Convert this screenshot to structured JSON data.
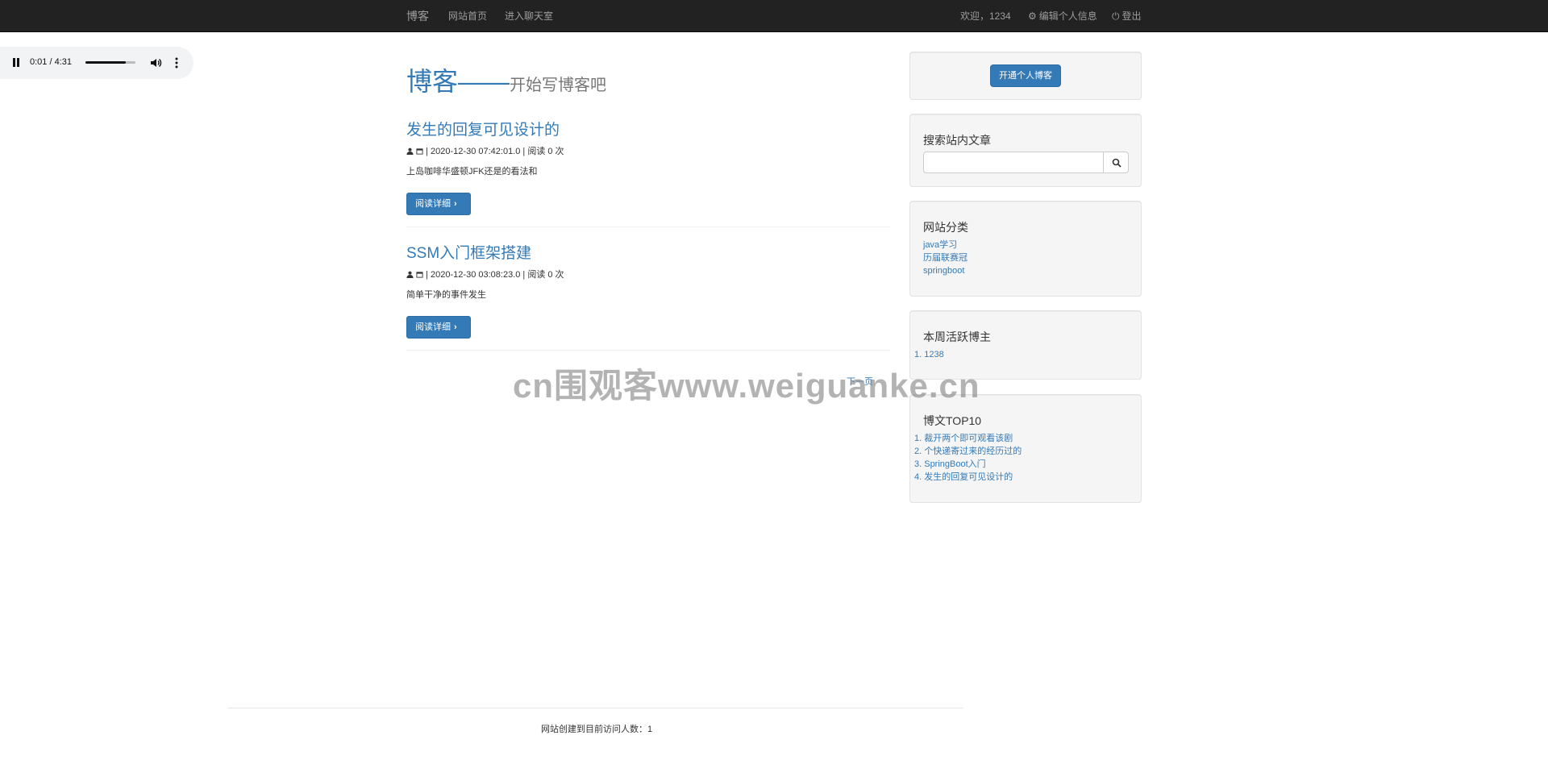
{
  "navbar": {
    "brand": "博客",
    "home": "网站首页",
    "chat": "进入聊天室",
    "welcome": "欢迎，1234",
    "edit_profile": "编辑个人信息",
    "logout": "登出"
  },
  "audio": {
    "time": "0:01 / 4:31",
    "progress": 0.004
  },
  "hero": {
    "title": "博客——",
    "subtitle": "开始写博客吧"
  },
  "posts": [
    {
      "title": "发生的回复可见设计的",
      "meta": "| 2020-12-30 07:42:01.0 | 阅读 0 次",
      "summary": "上岛咖啡华盛顿JFK还是的看法和",
      "button": "阅读详细"
    },
    {
      "title": "SSM入门框架搭建",
      "meta": "| 2020-12-30 03:08:23.0 | 阅读 0 次",
      "summary": "简单干净的事件发生",
      "button": "阅读详细"
    }
  ],
  "pager": {
    "next": "下一页"
  },
  "sidebar": {
    "open_blog": "开通个人博客",
    "search_title": "搜索站内文章",
    "search_value": "",
    "categories_title": "网站分类",
    "categories": [
      "java学习",
      "历届联赛冠",
      "springboot"
    ],
    "active_title": "本周活跃博主",
    "active_bloggers": [
      "1. 1238"
    ],
    "top_title": "博文TOP10",
    "top_posts": [
      "1. 裁开两个即可观看该剧",
      "2. 个快递寄过来的经历过的",
      "3. SpringBoot入门",
      "4. 发生的回复可见设计的"
    ]
  },
  "watermark": "cn围观客www.weiguanke.cn",
  "footer": {
    "text": "网站创建到目前访问人数：1"
  }
}
